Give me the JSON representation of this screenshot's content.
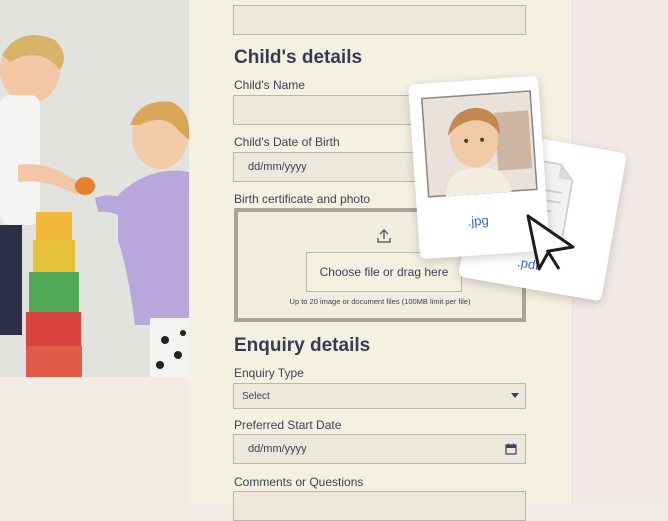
{
  "child_section": {
    "heading": "Child's details",
    "name_label": "Child's Name",
    "dob_label": "Child's Date of Birth",
    "dob_placeholder": "dd/mm/yyyy",
    "upload_label": "Birth certificate and photo",
    "upload_button": "Choose file or drag here",
    "upload_note": "Up to 20 image or document files (100MB limit per file)"
  },
  "enquiry_section": {
    "heading": "Enquiry details",
    "type_label": "Enquiry Type",
    "type_value": "Select",
    "start_label": "Preferred Start Date",
    "start_placeholder": "dd/mm/yyyy",
    "comments_label": "Comments or Questions"
  },
  "floating_files": {
    "jpg_label": ".jpg",
    "pdf_label": ".pdf"
  },
  "colors": {
    "panel": "#f4f0e2",
    "heading": "#383c52",
    "link_blue": "#3a66c4"
  }
}
